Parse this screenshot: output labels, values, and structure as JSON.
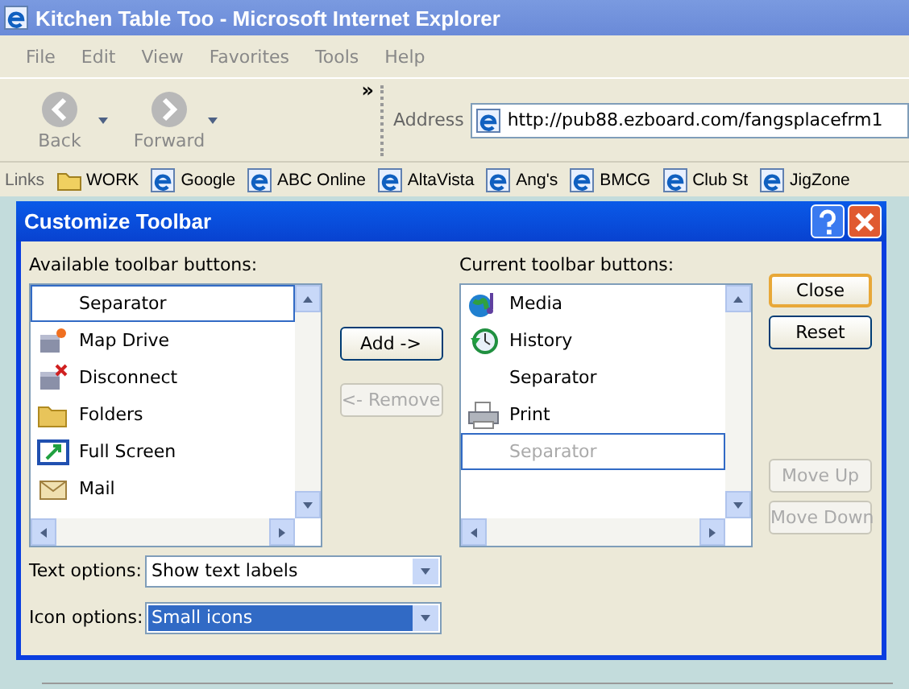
{
  "window": {
    "title": "Kitchen Table Too - Microsoft Internet Explorer"
  },
  "menu": [
    "File",
    "Edit",
    "View",
    "Favorites",
    "Tools",
    "Help"
  ],
  "toolbar": {
    "buttons": [
      {
        "label": "Back",
        "kind": "back",
        "disabled": true
      },
      {
        "label": "Forward",
        "kind": "forward",
        "disabled": true
      }
    ],
    "chevron": "»"
  },
  "address": {
    "label": "Address",
    "value": "http://pub88.ezboard.com/fangsplacefrm1"
  },
  "links": {
    "label": "Links",
    "items": [
      {
        "label": "WORK",
        "kind": "folder"
      },
      {
        "label": "Google",
        "kind": "page"
      },
      {
        "label": "ABC Online",
        "kind": "page"
      },
      {
        "label": "AltaVista",
        "kind": "page"
      },
      {
        "label": "Ang's",
        "kind": "page"
      },
      {
        "label": "BMCG",
        "kind": "page"
      },
      {
        "label": "Club St",
        "kind": "page"
      },
      {
        "label": "JigZone",
        "kind": "page"
      }
    ]
  },
  "dialog": {
    "title": "Customize Toolbar",
    "available": {
      "label": "Available toolbar buttons:",
      "items": [
        {
          "label": "Separator",
          "kind": "none",
          "focused": true,
          "disabled": false
        },
        {
          "label": "Map Drive",
          "kind": "drive-star",
          "focused": false,
          "disabled": false
        },
        {
          "label": "Disconnect",
          "kind": "drive-x",
          "focused": false,
          "disabled": false
        },
        {
          "label": "Folders",
          "kind": "folder",
          "focused": false,
          "disabled": false
        },
        {
          "label": "Full Screen",
          "kind": "fullscreen",
          "focused": false,
          "disabled": false
        },
        {
          "label": "Mail",
          "kind": "mail",
          "focused": false,
          "disabled": false
        }
      ]
    },
    "middle_buttons": [
      {
        "label": "Add ->",
        "disabled": false
      },
      {
        "label": "<- Remove",
        "disabled": true
      }
    ],
    "current": {
      "label": "Current toolbar buttons:",
      "items": [
        {
          "label": "Media",
          "kind": "globe",
          "focused": false,
          "disabled": false
        },
        {
          "label": "History",
          "kind": "history",
          "focused": false,
          "disabled": false
        },
        {
          "label": "Separator",
          "kind": "none",
          "focused": false,
          "disabled": false
        },
        {
          "label": "Print",
          "kind": "printer",
          "focused": false,
          "disabled": false
        },
        {
          "label": "Separator",
          "kind": "none",
          "focused": true,
          "disabled": true
        }
      ]
    },
    "side_buttons": [
      {
        "label": "Close",
        "default": true,
        "disabled": false
      },
      {
        "label": "Reset",
        "default": false,
        "disabled": false
      },
      {
        "label": "Move Up",
        "default": false,
        "disabled": true
      },
      {
        "label": "Move Down",
        "default": false,
        "disabled": true
      }
    ],
    "options": [
      {
        "label": "Text options:",
        "value": "Show text labels",
        "selected": false
      },
      {
        "label": "Icon options:",
        "value": "Small icons",
        "selected": true
      }
    ]
  }
}
